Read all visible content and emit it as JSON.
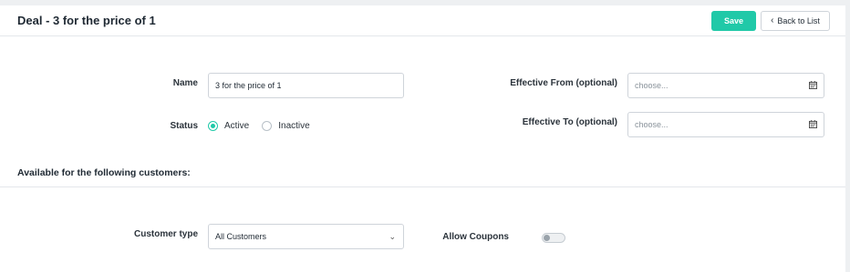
{
  "header": {
    "title": "Deal - 3 for the price of 1",
    "save_label": "Save",
    "back_label": "Back to List"
  },
  "form": {
    "name_label": "Name",
    "name_value": "3 for the price of 1",
    "status_label": "Status",
    "status_options": [
      "Active",
      "Inactive"
    ],
    "status_selected": "Active",
    "effective_from_label": "Effective From (optional)",
    "effective_from_placeholder": "choose...",
    "effective_to_label": "Effective To (optional)",
    "effective_to_placeholder": "choose..."
  },
  "customers": {
    "section_title": "Available for the following customers:",
    "customer_type_label": "Customer type",
    "customer_type_value": "All Customers",
    "allow_coupons_label": "Allow Coupons",
    "allow_coupons_on": false
  },
  "colors": {
    "accent": "#20c9a8",
    "background": "#eef0f2",
    "border": "#cfd4da"
  },
  "icons": [
    "chevron-left-icon",
    "calendar-icon",
    "chevron-down-icon"
  ]
}
